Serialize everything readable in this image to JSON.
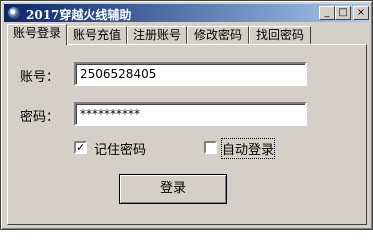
{
  "window": {
    "title": "2017穿越火线辅助",
    "minimize_glyph": "_",
    "maximize_glyph": "□",
    "close_glyph": "×"
  },
  "tabs": [
    {
      "label": "账号登录",
      "active": true
    },
    {
      "label": "账号充值",
      "active": false
    },
    {
      "label": "注册账号",
      "active": false
    },
    {
      "label": "修改密码",
      "active": false
    },
    {
      "label": "找回密码",
      "active": false
    }
  ],
  "form": {
    "account_label": "账号：",
    "account_value": "2506528405",
    "password_label": "密码：",
    "password_value": "**********",
    "remember_label": "记住密码",
    "remember_checked": true,
    "autologin_label": "自动登录",
    "autologin_checked": false,
    "login_button": "登录"
  },
  "icons": {
    "app": "app-icon",
    "minimize": "minimize-icon",
    "maximize": "maximize-icon",
    "close": "close-icon",
    "checkmark": "check-icon"
  }
}
